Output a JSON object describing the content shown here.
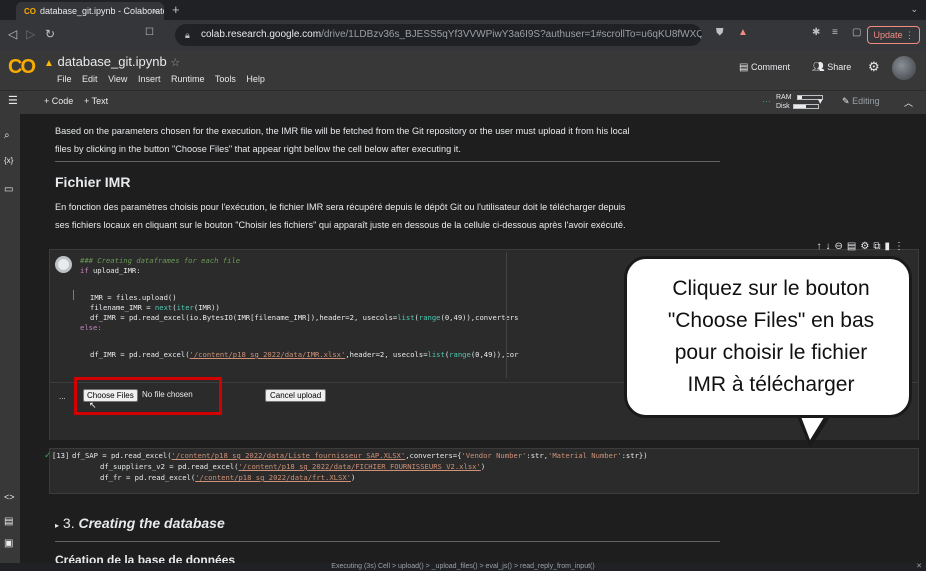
{
  "browser": {
    "tab_title": "database_git.ipynb - Colaboratory",
    "tab_close": "×",
    "new_tab": "+",
    "url_host": "colab.research.google.com",
    "url_path": "/drive/1LDBzv36s_BJESS5qYf3VVWPiwY3a6I9S?authuser=1#scrollTo=u6qKU8fWXQKo",
    "update_label": "Update"
  },
  "colab": {
    "notebook_name": "database_git.ipynb",
    "menus": [
      "File",
      "Edit",
      "View",
      "Insert",
      "Runtime",
      "Tools",
      "Help"
    ],
    "comment_label": "Comment",
    "share_label": "Share",
    "add_code": "+ Code",
    "add_text": "+ Text",
    "ram_label": "RAM",
    "disk_label": "Disk",
    "ram_fraction": 0.2,
    "disk_fraction": 0.5,
    "editing_label": "Editing"
  },
  "content": {
    "para_en_1": "Based on the parameters chosen for the execution, the IMR file will be fetched from the Git repository or the user must upload it from his local",
    "para_en_2": "files by clicking in the button \"Choose Files\" that appear right bellow the cell below after executing it.",
    "heading_fr": "Fichier IMR",
    "para_fr_1": "En fonction des paramètres choisis pour l'exécution, le fichier IMR sera récupéré depuis le dépôt Git ou l'utilisateur doit le télécharger depuis",
    "para_fr_2": "ses fichiers locaux en cliquant sur le bouton \"Choisir les fichiers\" qui apparaît juste en dessous de la cellule ci-dessous après l'avoir exécuté.",
    "section_number": "3.",
    "section_title": "Creating the database",
    "next_heading_partial": "Création de la base de données"
  },
  "cell1": {
    "line1": "### Creating dataframes for each file",
    "line2_kw": "if",
    "line2_rest": " upload_IMR:",
    "line3": "IMR = files.upload()",
    "line4_a": "filename_IMR = ",
    "line4_b": "next",
    "line4_c": "(",
    "line4_d": "iter",
    "line4_e": "(IMR))",
    "line5_a": "df_IMR = pd.read_excel(io.BytesIO(IMR[filename_IMR]),header=2, usecols=",
    "line5_b": "list",
    "line5_c": "(",
    "line5_d": "range",
    "line5_e": "(0,49)),converters",
    "line6": "else:",
    "line7_a": "df_IMR = pd.read_excel(",
    "line7_b": "'/content/p18_sg_2022/data/IMR.xlsx'",
    "line7_c": ",header=2, usecols=",
    "line7_d": "list",
    "line7_e": "(",
    "line7_f": "range",
    "line7_g": "(0,49)),cor",
    "choose_files": "Choose Files",
    "no_file": "No file chosen",
    "cancel_upload": "Cancel upload",
    "ellipsis": "..."
  },
  "cell2": {
    "exec_count": "[13]",
    "l1_a": "df_SAP = pd.read_excel(",
    "l1_b": "'/content/p18_sg_2022/data/Liste fournisseur SAP.XLSX'",
    "l1_c": ",converters={",
    "l1_d": "'Vendor Number'",
    "l1_e": ":str,",
    "l1_f": "'Material Number'",
    "l1_g": ":str})",
    "l2_a": "df_suppliers_v2 = pd.read_excel(",
    "l2_b": "'/content/p18_sg_2022/data/FICHIER FOURNISSEURS V2.xlsx'",
    "l2_c": ")",
    "l3_a": "df_fr = pd.read_excel(",
    "l3_b": "'/content/p18_sg_2022/data/frt.XLSX'",
    "l3_c": ")"
  },
  "callout": {
    "line1": "Cliquez sur le bouton",
    "line2": "\"Choose Files\" en bas",
    "line3": "pour choisir le fichier",
    "line4": "IMR à télécharger"
  },
  "status": {
    "text": "Executing (3s) Cell > upload() > _upload_files() > eval_js() > read_reply_from_input()"
  },
  "icons": [
    "colab-logo",
    "drive-icon",
    "star-icon",
    "lock-icon",
    "comment-icon",
    "share-icon",
    "gear-icon",
    "search-icon",
    "variables-icon",
    "files-icon",
    "code-snippets-icon",
    "terminal-icon",
    "pencil-icon"
  ]
}
